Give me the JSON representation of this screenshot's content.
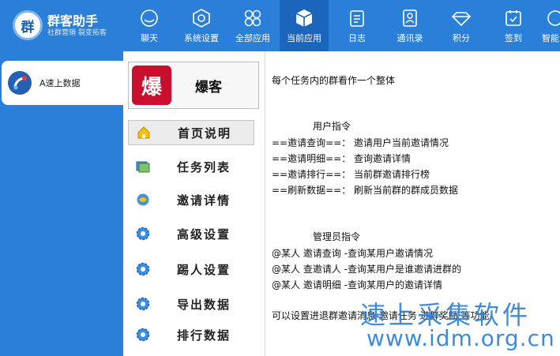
{
  "app": {
    "logo_char": "群",
    "name": "群客助手",
    "slogan": "社群营销 裂变拓客"
  },
  "nav": [
    {
      "label": "聊天",
      "icon": "chat-icon"
    },
    {
      "label": "系统设置",
      "icon": "settings-hexagon-icon"
    },
    {
      "label": "全部应用",
      "icon": "all-apps-icon"
    },
    {
      "label": "当前应用",
      "icon": "current-app-cube-icon",
      "active": true
    },
    {
      "label": "日志",
      "icon": "log-icon"
    },
    {
      "label": "通讯录",
      "icon": "contacts-icon"
    },
    {
      "label": "积分",
      "icon": "points-diamond-icon"
    },
    {
      "label": "签到",
      "icon": "checkin-icon"
    },
    {
      "label": "智能",
      "icon": "smart-icon"
    }
  ],
  "sidebar": {
    "app_label": "A速上数据"
  },
  "app_card": {
    "image_text": "爆",
    "title": "爆客"
  },
  "menu": [
    {
      "label": "首页说明",
      "icon": "home-icon",
      "selected": true
    },
    {
      "label": "任务列表",
      "icon": "task-list-icon"
    },
    {
      "label": "邀请详情",
      "icon": "invite-detail-icon"
    },
    {
      "label": "高级设置",
      "icon": "gear-icon"
    },
    {
      "label": "踢人设置",
      "icon": "gear-icon"
    },
    {
      "label": "导出数据",
      "icon": "gear-icon"
    },
    {
      "label": "排行数据",
      "icon": "gear-icon"
    }
  ],
  "content": {
    "intro": "每个任务内的群看作一个整体",
    "user_title": "用户指令",
    "user_cmds": [
      "==邀请查询==：  邀请用户当前邀请情况",
      "==邀请明细==：  查询邀请详情",
      "==邀请排行==：  当前群邀请排行榜",
      "==刷新数据==：  刷新当前群的群成员数据"
    ],
    "admin_title": "管理员指令",
    "admin_cmds": [
      "@某人  邀请查询   -查询某用户邀请情况",
      "@某人  查邀请人   -查询某用户是谁邀请进群的",
      "@某人  邀请明细   -查询某用户的邀请详情"
    ],
    "footer": "可以设置进退群邀请消息 邀请任务 进群奖励 等功能"
  },
  "watermark": {
    "line1": "速上采集软件",
    "line2": "www.idm.org.cn"
  },
  "colors": {
    "topbar": "#2a7fd8",
    "active_tab": "#1b65bd",
    "sidebar": "#2a7fd8"
  }
}
